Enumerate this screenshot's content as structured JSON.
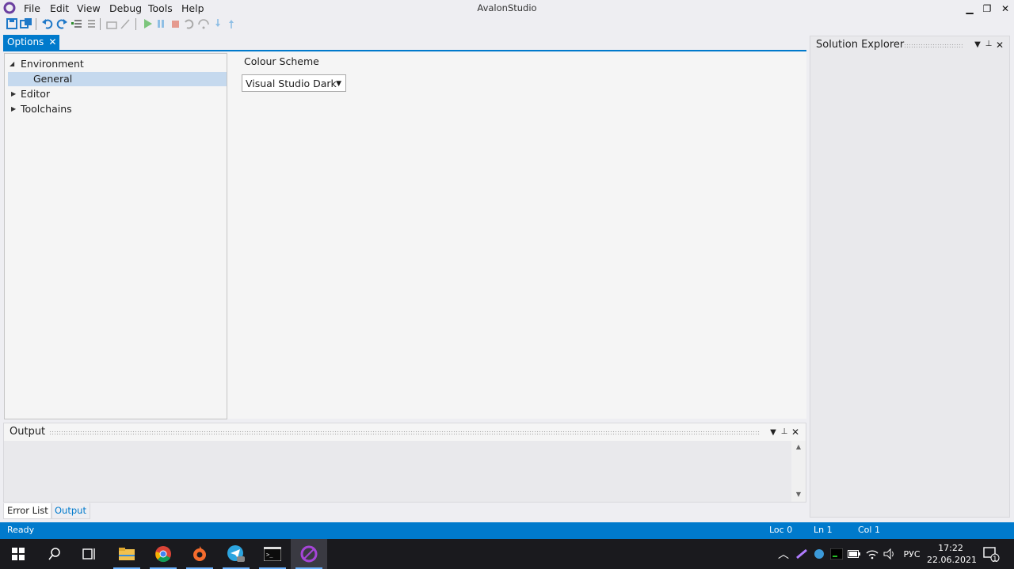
{
  "app": {
    "title": "AvalonStudio"
  },
  "menu": [
    "File",
    "Edit",
    "View",
    "Debug",
    "Tools",
    "Help"
  ],
  "window_controls": {
    "minimize": "▁",
    "restore": "❐",
    "close": "✕"
  },
  "toolbar": [
    "save-icon",
    "save-all-icon",
    "undo-icon",
    "redo-icon",
    "comment-icon",
    "uncomment-icon",
    "build-icon",
    "clean-icon",
    "start-icon",
    "pause-icon",
    "stop-icon",
    "restart-icon",
    "step-over-icon",
    "step-into-icon",
    "step-out-icon"
  ],
  "doc_tab": {
    "label": "Options"
  },
  "options_tree": [
    {
      "label": "Environment",
      "expanded": true
    },
    {
      "label": "General",
      "selected": true
    },
    {
      "label": "Editor",
      "expanded": false
    },
    {
      "label": "Toolchains",
      "expanded": false
    }
  ],
  "settings": {
    "colour_scheme_label": "Colour Scheme",
    "colour_scheme_value": "Visual Studio Dark"
  },
  "solution_explorer": {
    "title": "Solution Explorer"
  },
  "output_panel": {
    "title": "Output"
  },
  "bottom_tabs": {
    "error_list": "Error List",
    "output": "Output"
  },
  "status": {
    "ready": "Ready",
    "loc": "Loc 0",
    "ln": "Ln 1",
    "col": "Col 1"
  },
  "taskbar": {
    "apps": [
      "windows-start-icon",
      "search-icon",
      "task-view-icon",
      "file-explorer-icon",
      "chrome-icon",
      "origin-icon",
      "telegram-icon",
      "terminal-icon",
      "avalonstudio-icon"
    ],
    "language": "РУС",
    "time": "17:22",
    "date": "22.06.2021",
    "notification_count": "1"
  },
  "colors": {
    "accent": "#007acc",
    "selection": "#c5d9ee",
    "taskbar": "#1a1a1e"
  }
}
